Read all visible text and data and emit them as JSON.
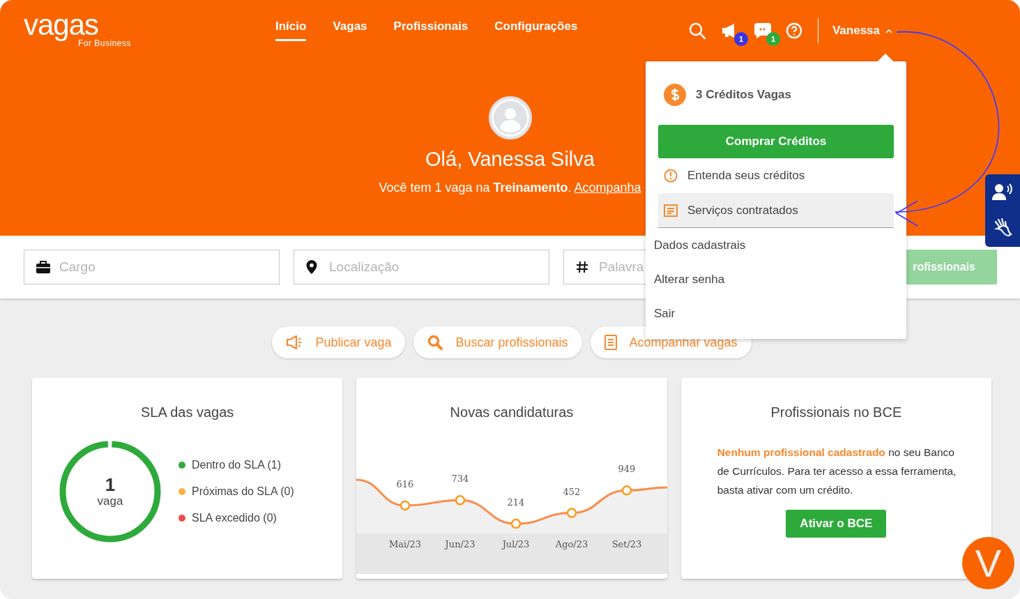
{
  "header": {
    "logo": "vagas",
    "logo_sub": "For Business",
    "nav": [
      {
        "label": "Início",
        "selected": true
      },
      {
        "label": "Vagas",
        "selected": false
      },
      {
        "label": "Profissionais",
        "selected": false
      },
      {
        "label": "Configurações",
        "selected": false
      }
    ],
    "notifications": {
      "announcements": "1",
      "messages": "1"
    },
    "user": "Vanessa"
  },
  "hero": {
    "greeting": "Olá, Vanessa Silva",
    "message": "Você tem 1 vaga na **Treinamento**. ",
    "link": "Acompanha"
  },
  "search": {
    "fields": [
      {
        "kind": "briefcase",
        "placeholder": "Cargo"
      },
      {
        "kind": "pin",
        "placeholder": "Localização"
      },
      {
        "kind": "hash",
        "placeholder": "Palavra"
      }
    ],
    "button": "rofissionais"
  },
  "user_menu": {
    "credits": "3 Créditos Vagas",
    "buy_button": "Comprar Créditos",
    "items": [
      {
        "kind": "info",
        "label": "Entenda seus créditos",
        "selected": false
      },
      {
        "kind": "document",
        "label": "Serviços contratados",
        "selected": true
      },
      {
        "kind": "plain",
        "label": "Dados cadastrais",
        "selected": false
      },
      {
        "kind": "plain",
        "label": "Alterar senha",
        "selected": false
      },
      {
        "kind": "plain",
        "label": "Sair",
        "selected": false
      }
    ]
  },
  "quick_actions": [
    {
      "kind": "megaphone",
      "label": "Publicar vaga"
    },
    {
      "kind": "search",
      "label": "Buscar profissionais"
    },
    {
      "kind": "list",
      "label": "Acompanhar vagas"
    }
  ],
  "sla_card": {
    "title": "SLA das vagas",
    "count": "1",
    "unit": "vaga",
    "legend": [
      {
        "label": "Dentro do SLA (1)",
        "color": "#2eaa3c"
      },
      {
        "label": "Próximas do SLA (0)",
        "color": "#fbb040"
      },
      {
        "label": "SLA excedido (0)",
        "color": "#ef4b4b"
      }
    ]
  },
  "applications_card": {
    "title": "Novas candidaturas",
    "chart_data": {
      "type": "line",
      "categories": [
        "Mai/23",
        "Jun/23",
        "Jul/23",
        "Ago/23",
        "Set/23"
      ],
      "series": [
        {
          "color": "#fb8c4a",
          "marker": true,
          "values": [
            616,
            734,
            214,
            452,
            949
          ]
        }
      ],
      "data_labels": true
    }
  },
  "bce_card": {
    "title": "Profissionais no BCE",
    "text": "**Nenhum profissional cadastrado** no seu Banco de Currículos. Para ter acesso a essa ferramenta, basta ativar com um crédito.",
    "button": "Ativar o BCE"
  },
  "chat_logo": "V"
}
